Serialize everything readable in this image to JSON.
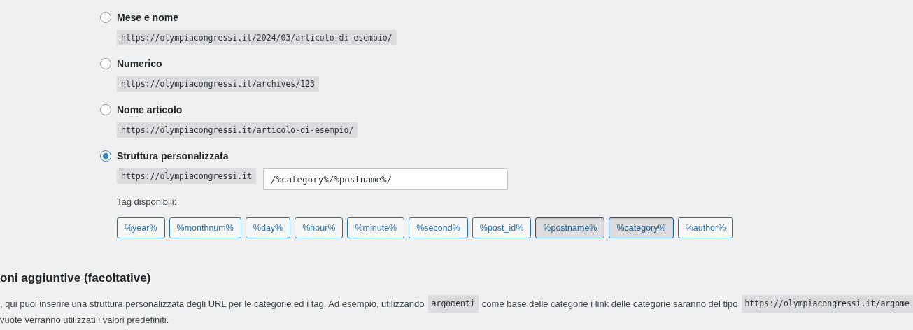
{
  "permalink_options": [
    {
      "label": "Mese e nome",
      "example": "https://olympiacongressi.it/2024/03/articolo-di-esempio/",
      "selected": false
    },
    {
      "label": "Numerico",
      "example": "https://olympiacongressi.it/archives/123",
      "selected": false
    },
    {
      "label": "Nome articolo",
      "example": "https://olympiacongressi.it/articolo-di-esempio/",
      "selected": false
    },
    {
      "label": "Struttura personalizzata",
      "selected": true,
      "prefix": "https://olympiacongressi.it",
      "value": "/%category%/%postname%/"
    }
  ],
  "tags_label": "Tag disponibili:",
  "tags": [
    {
      "label": "%year%",
      "selected": false
    },
    {
      "label": "%monthnum%",
      "selected": false
    },
    {
      "label": "%day%",
      "selected": false
    },
    {
      "label": "%hour%",
      "selected": false
    },
    {
      "label": "%minute%",
      "selected": false
    },
    {
      "label": "%second%",
      "selected": false
    },
    {
      "label": "%post_id%",
      "selected": false
    },
    {
      "label": "%postname%",
      "selected": true
    },
    {
      "label": "%category%",
      "selected": true
    },
    {
      "label": "%author%",
      "selected": false
    }
  ],
  "section_heading": "oni aggiuntive (facoltative)",
  "paragraph_lines": [
    [
      {
        "kind": "text",
        "text": ", qui puoi inserire una struttura personalizzata degli URL per le categorie ed i tag. Ad esempio, utilizzando"
      },
      {
        "kind": "code",
        "text": "argomenti"
      },
      {
        "kind": "text",
        "text": "come base delle categorie i link delle categorie saranno del tipo"
      },
      {
        "kind": "code",
        "text": "https://olympiacongressi.it/argome"
      }
    ],
    [
      {
        "kind": "text",
        "text": "vuote verranno utilizzati i valori predefiniti."
      }
    ]
  ]
}
